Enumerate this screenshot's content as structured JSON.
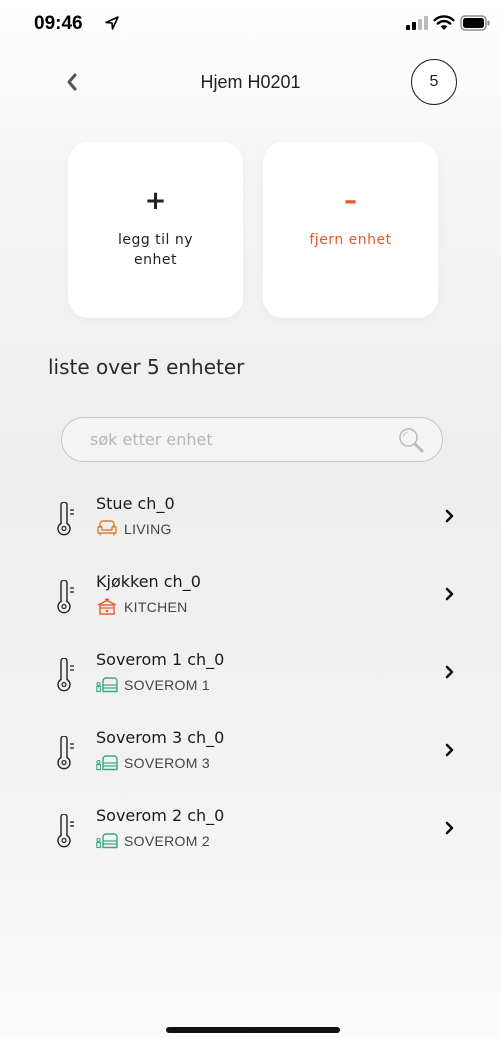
{
  "status_bar": {
    "time": "09:46"
  },
  "header": {
    "title": "Hjem H0201",
    "device_count": "5"
  },
  "actions": {
    "add": {
      "sign": "+",
      "label": "legg til ny enhet"
    },
    "remove": {
      "sign": "–",
      "label": "fjern enhet"
    }
  },
  "list": {
    "heading": "liste over 5 enheter",
    "search_placeholder": "søk etter enhet",
    "items": [
      {
        "name": "Stue ch_0",
        "room": "LIVING",
        "room_icon": "sofa-icon"
      },
      {
        "name": "Kjøkken ch_0",
        "room": "KITCHEN",
        "room_icon": "kitchen-icon"
      },
      {
        "name": "Soverom 1 ch_0",
        "room": "SOVEROM 1",
        "room_icon": "bed-icon"
      },
      {
        "name": "Soverom 3 ch_0",
        "room": "SOVEROM 3",
        "room_icon": "bed-icon"
      },
      {
        "name": "Soverom 2 ch_0",
        "room": "SOVEROM 2",
        "room_icon": "bed-icon"
      }
    ]
  },
  "colors": {
    "accent_remove": "#e8582a",
    "living_icon": "#d9822b",
    "kitchen_icon": "#e8582a",
    "bedroom_icon": "#3aa87a"
  }
}
